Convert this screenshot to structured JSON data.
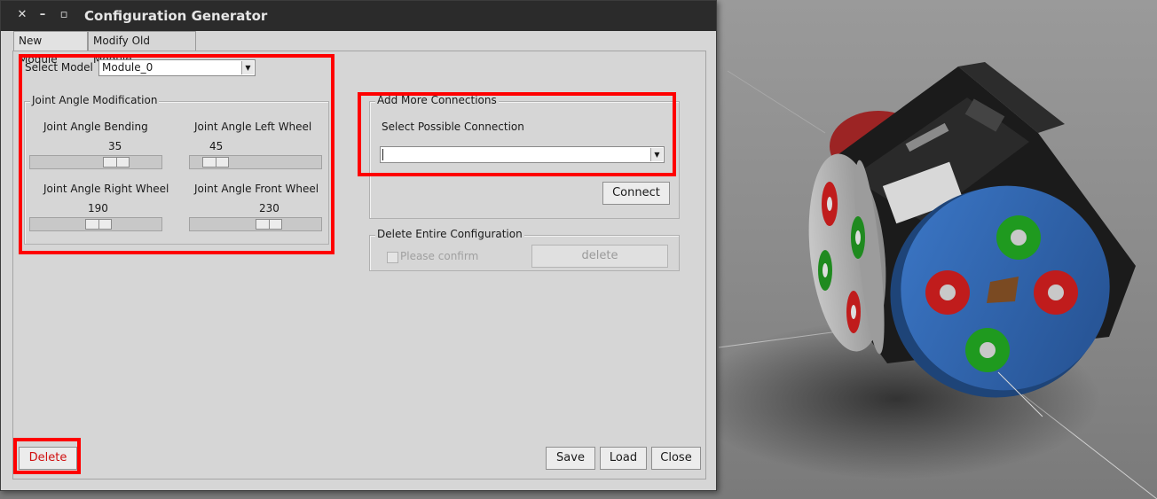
{
  "window": {
    "title": "Configuration Generator"
  },
  "titlebar_buttons": {
    "close": "✕",
    "minimize": "–",
    "maximize": "▫"
  },
  "tabs": [
    {
      "label": "New Module",
      "active": false
    },
    {
      "label": "Modify Old Module",
      "active": true
    }
  ],
  "select_model": {
    "label": "Select Model",
    "value": "Module_0"
  },
  "joint_angle": {
    "title": "Joint Angle Modification",
    "sliders": [
      {
        "label": "Joint Angle Bending",
        "value": "35"
      },
      {
        "label": "Joint Angle Left Wheel",
        "value": "45"
      },
      {
        "label": "Joint Angle Right Wheel",
        "value": "190"
      },
      {
        "label": "Joint Angle Front Wheel",
        "value": "230"
      }
    ]
  },
  "connections": {
    "title": "Add More Connections",
    "select_label": "Select Possible Connection",
    "select_value": "",
    "connect_label": "Connect"
  },
  "delete_config": {
    "title": "Delete Entire Configuration",
    "confirm_label": "Please confirm",
    "delete_label": "delete"
  },
  "footer": {
    "delete_label": "Delete",
    "save_label": "Save",
    "load_label": "Load",
    "close_label": "Close"
  },
  "colors": {
    "highlight": "#ff0000",
    "delete_text": "#d01010"
  }
}
